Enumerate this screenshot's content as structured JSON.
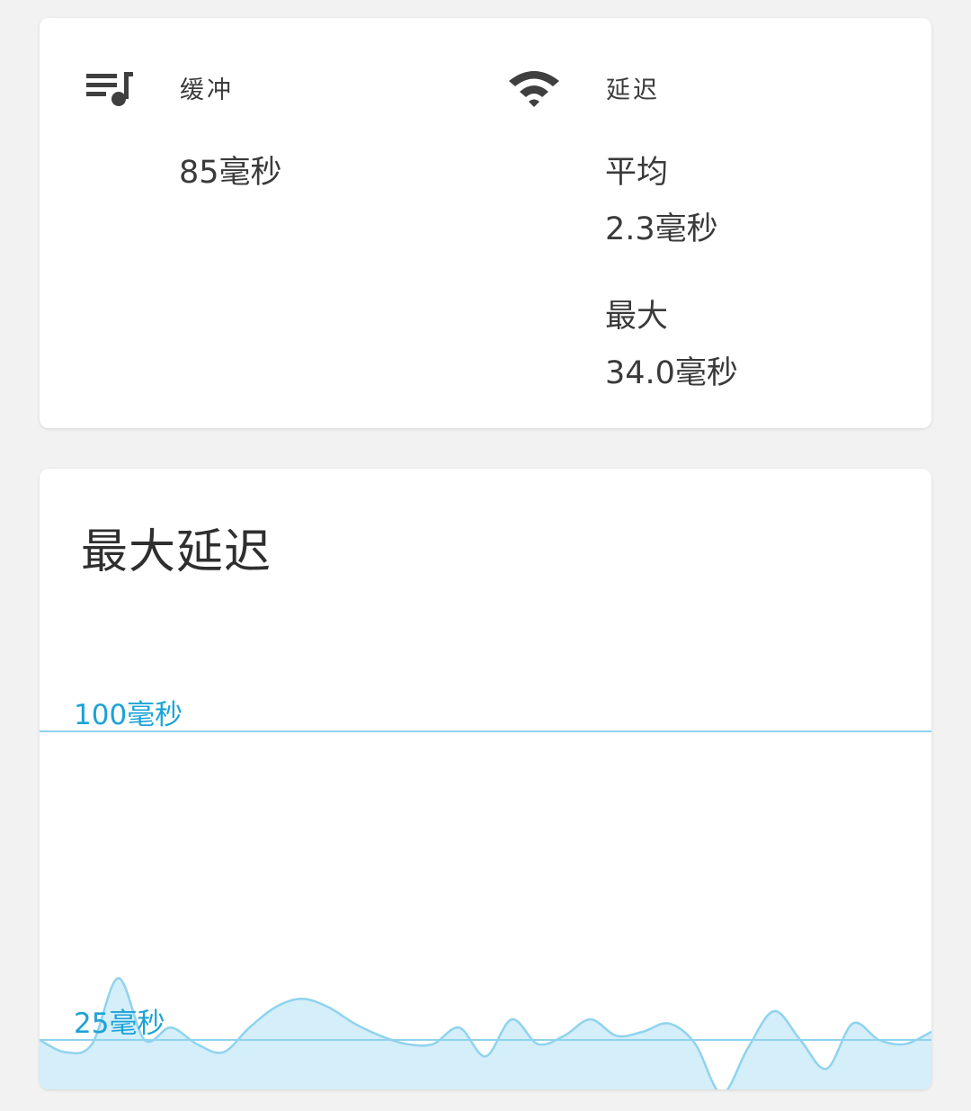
{
  "buffer": {
    "icon": "playlist-music-icon",
    "label": "缓冲",
    "value": "85毫秒"
  },
  "latency": {
    "icon": "wifi-icon",
    "label": "延迟",
    "average_label": "平均",
    "average_value": "2.3毫秒",
    "max_label": "最大",
    "max_value": "34.0毫秒"
  },
  "chart": {
    "title": "最大延迟",
    "colors": {
      "line": "#8fd3ee",
      "fill": "#d4eefa",
      "reference": "#8fd3ee",
      "label": "#1aa3d6"
    }
  },
  "chart_data": {
    "type": "area",
    "title": "最大延迟",
    "reference_lines": [
      {
        "value": 100,
        "label": "100毫秒"
      },
      {
        "value": 25,
        "label": "25毫秒"
      }
    ],
    "ylim": [
      0,
      125
    ],
    "values": [
      25,
      22,
      24,
      40,
      25,
      28,
      24,
      22,
      28,
      33,
      35,
      33,
      29,
      26,
      24,
      24,
      28,
      21,
      30,
      24,
      26,
      30,
      26,
      27,
      29,
      24,
      12,
      23,
      32,
      25,
      18,
      29,
      25,
      24,
      27
    ],
    "grid": false
  }
}
